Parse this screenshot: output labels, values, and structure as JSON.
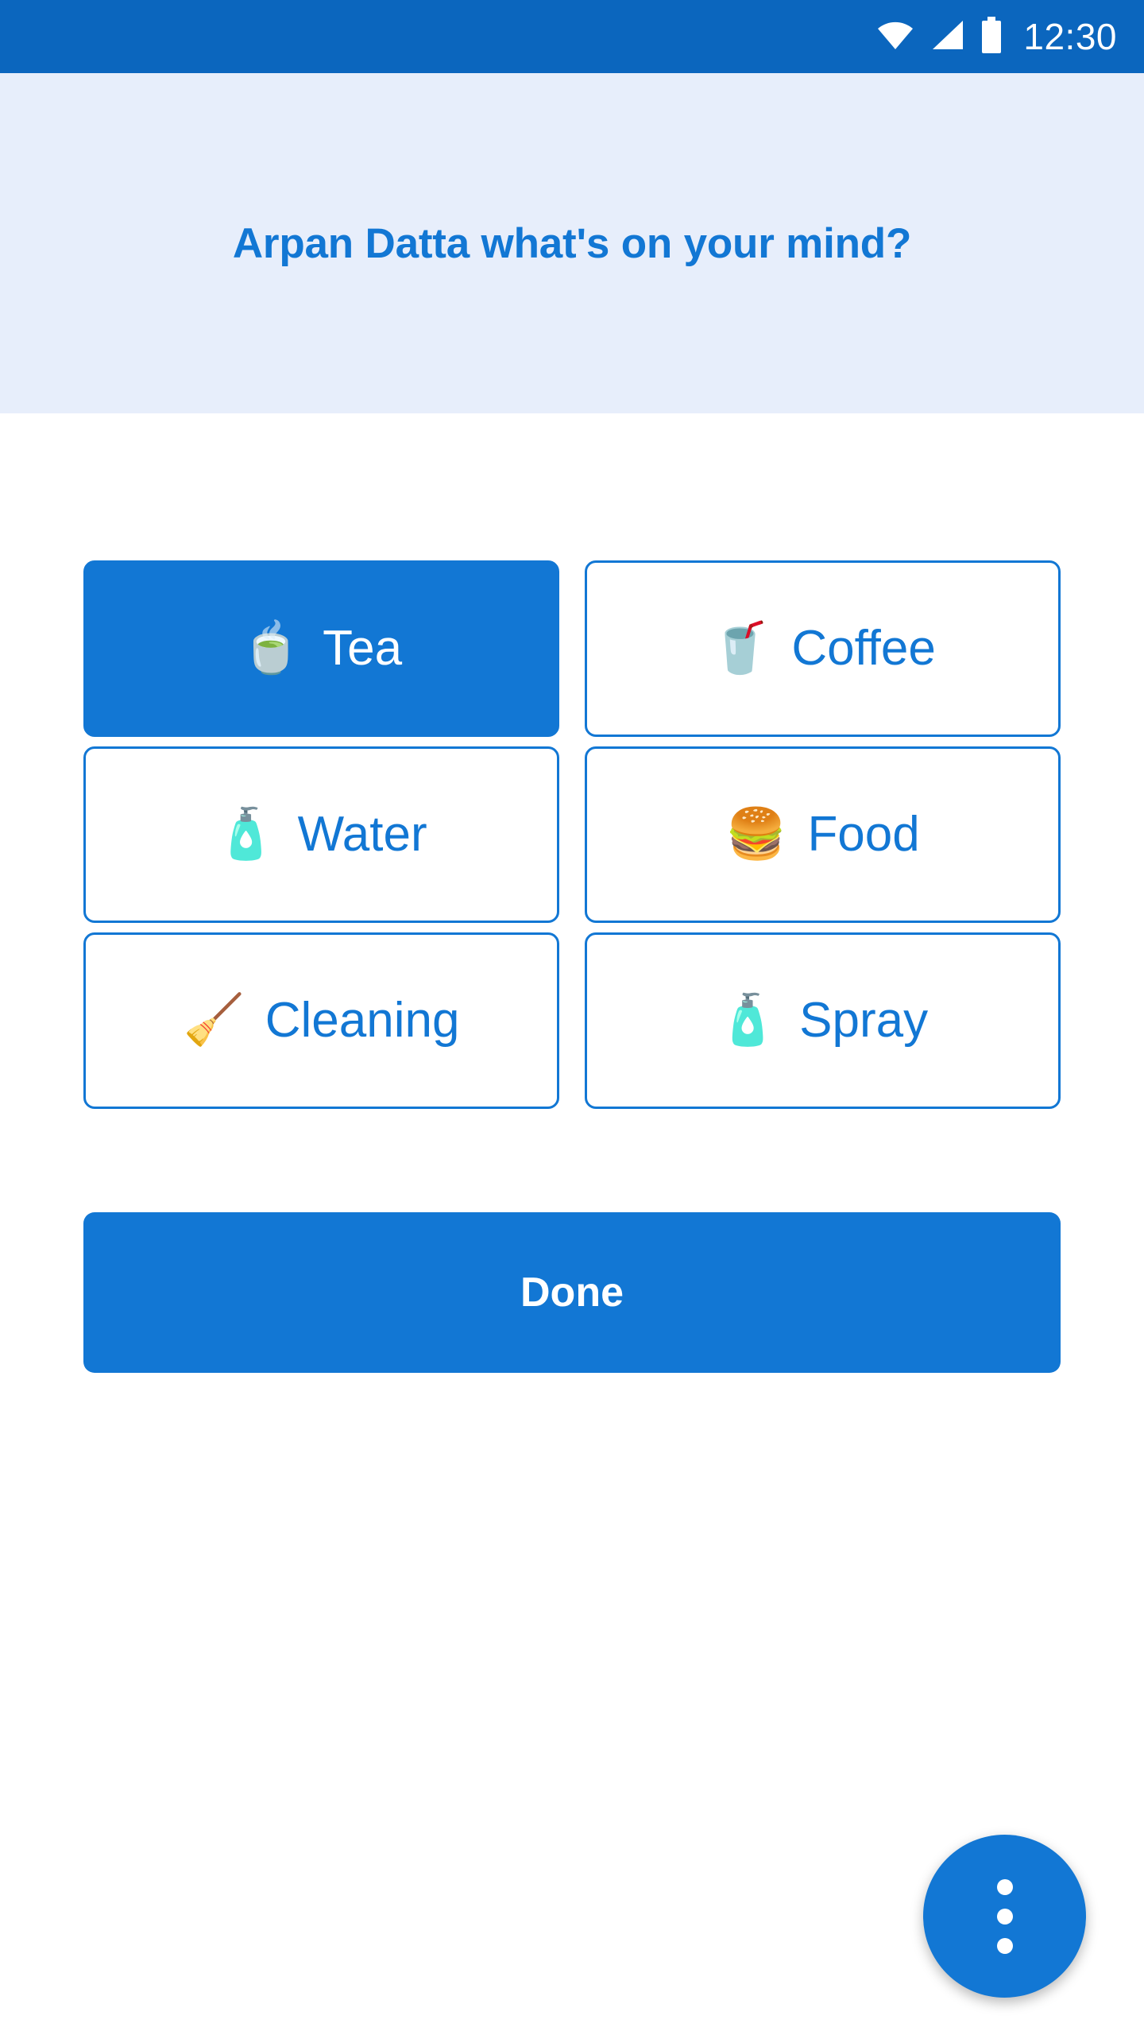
{
  "status_bar": {
    "time": "12:30",
    "icons": [
      "wifi-icon",
      "cellular-signal-icon",
      "battery-icon"
    ],
    "background_color": "#0b66be"
  },
  "header": {
    "title": "Arpan Datta what's on your mind?",
    "background_color": "#e7eefb",
    "text_color": "#1277d4"
  },
  "theme": {
    "accent_color": "#1277d4",
    "status_bar_color": "#0b66be",
    "surface_color": "#ffffff",
    "header_band_color": "#e7eefb"
  },
  "options": [
    {
      "label": "Tea",
      "emoji": "🍵",
      "icon_name": "teacup-icon",
      "selected": true
    },
    {
      "label": "Coffee",
      "emoji": "🥤",
      "icon_name": "coffee-cup-icon",
      "selected": false
    },
    {
      "label": "Water",
      "emoji": "🧴",
      "icon_name": "water-bottle-icon",
      "selected": false
    },
    {
      "label": "Food",
      "emoji": "🍔",
      "icon_name": "burger-icon",
      "selected": false
    },
    {
      "label": "Cleaning",
      "emoji": "🧹",
      "icon_name": "broom-icon",
      "selected": false
    },
    {
      "label": "Spray",
      "emoji": "🧴",
      "icon_name": "spray-bottle-icon",
      "selected": false
    }
  ],
  "done_button": {
    "label": "Done"
  },
  "fab": {
    "icon_name": "overflow-menu-vertical-icon",
    "dot_count": 3
  }
}
